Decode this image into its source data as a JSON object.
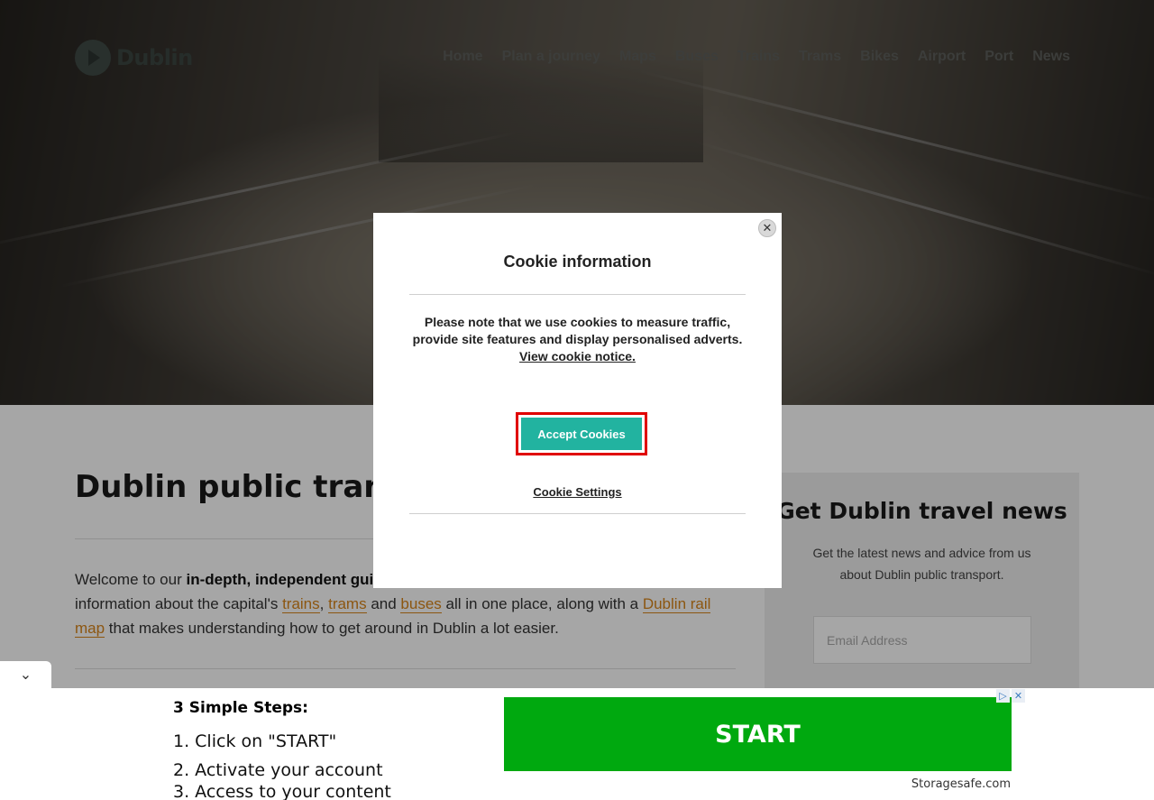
{
  "site": {
    "logo_text": "Dublin",
    "nav": [
      "Home",
      "Plan a journey",
      "Maps",
      "Buses",
      "Trains",
      "Trams",
      "Bikes",
      "Airport",
      "Port",
      "News"
    ]
  },
  "main": {
    "title": "Dublin public transport",
    "intro": {
      "welcome": "Welcome to our ",
      "bold": "in-depth, independent guide",
      "after_bold": " to public transport in Dublin. Here you'll find information about the capital's ",
      "link_trains": "trains",
      "comma": ", ",
      "link_trams": "trams",
      "and": " and ",
      "link_buses": "buses",
      "mid": " all in one place, along with a ",
      "link_railmap": "Dublin rail map",
      "end": " that makes understanding how to get around in Dublin a lot easier."
    }
  },
  "sidebar": {
    "title": "Get Dublin travel news",
    "text": "Get the latest news and advice from us about Dublin public transport.",
    "email_placeholder": "Email Address"
  },
  "cookie_modal": {
    "close_glyph": "✕",
    "title": "Cookie information",
    "message": "Please note that we use cookies to measure traffic, provide site features and display personalised adverts.",
    "notice_link": "View cookie notice.",
    "accept_label": "Accept Cookies",
    "settings_label": "Cookie Settings"
  },
  "ad": {
    "toggle_glyph": "⌄",
    "steps_title": "3 Simple Steps:",
    "steps": [
      "1. Click on \"START\"",
      "2. Activate your account",
      "3. Access to your content"
    ],
    "start_label": "START",
    "brand": "Storagesafe.com",
    "adchoice_icons": [
      "▷",
      "✕"
    ]
  }
}
